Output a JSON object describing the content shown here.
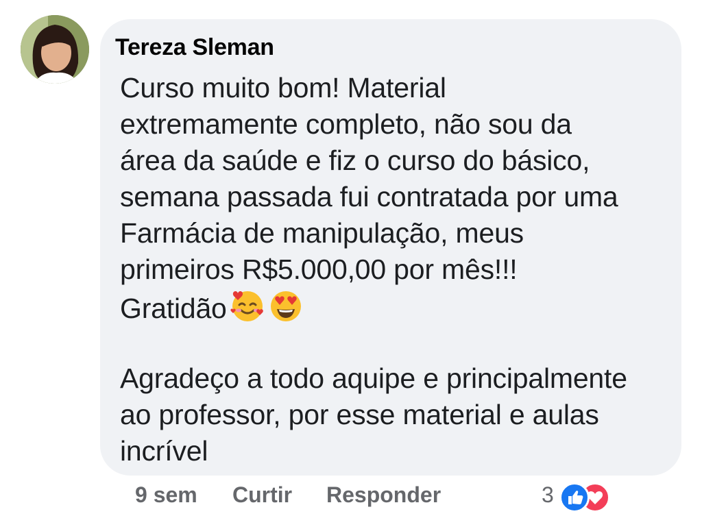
{
  "comment": {
    "author": "Tereza Sleman",
    "lines": [
      "Curso muito bom! Material",
      "extremamente completo, não sou da",
      "área da saúde e fiz o curso do básico,",
      "semana passada fui contratada por uma",
      "Farmácia de manipulação, meus",
      "primeiros R$5.000,00 por mês!!!",
      "Gratidão"
    ],
    "lines2": [
      "Agradeço a todo aquipe e principalmente",
      "ao professor, por esse material e aulas",
      "incrível"
    ]
  },
  "actions": {
    "time": "9 sem",
    "like_label": "Curtir",
    "reply_label": "Responder",
    "reaction_count": "3",
    "reaction_icons": [
      "like-icon",
      "love-icon"
    ]
  },
  "colors": {
    "bubble": "#f0f2f5",
    "like": "#1877f2",
    "love": "#f33e58",
    "meta_text": "#65676b"
  }
}
